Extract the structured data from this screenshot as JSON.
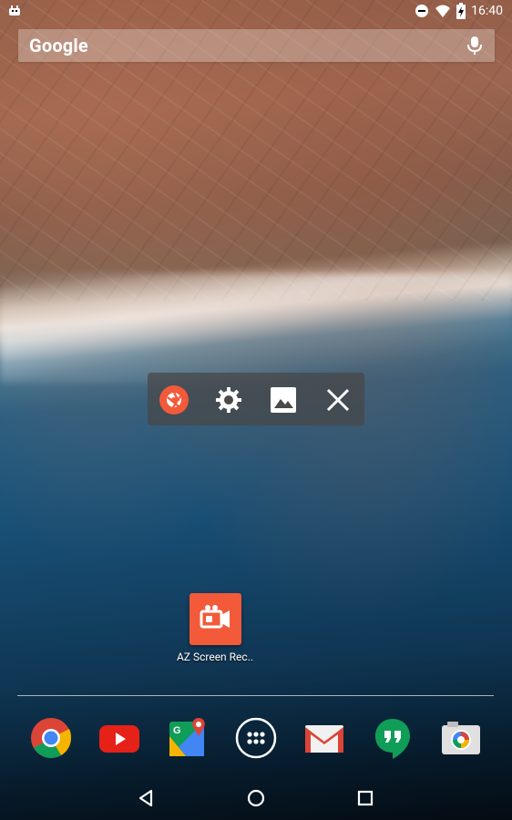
{
  "status_bar": {
    "time": "16:40",
    "icons": [
      "android-notification-icon",
      "do-not-disturb-icon",
      "wifi-icon",
      "battery-charging-icon"
    ]
  },
  "search_bar": {
    "logo_text": "Google",
    "icon": "mic-icon"
  },
  "floating_toolbar": {
    "items": [
      {
        "name": "record-shutter-icon",
        "accent": "#f25a3a"
      },
      {
        "name": "settings-gear-icon"
      },
      {
        "name": "gallery-image-icon"
      },
      {
        "name": "close-x-icon"
      }
    ]
  },
  "home_app": {
    "label": "AZ Screen Rec..",
    "icon": "camera-record-icon",
    "color": "#f25a3a"
  },
  "dock": {
    "items": [
      {
        "name": "chrome-icon"
      },
      {
        "name": "youtube-icon",
        "color": "#e62117"
      },
      {
        "name": "maps-icon"
      },
      {
        "name": "app-drawer-icon"
      },
      {
        "name": "gmail-icon"
      },
      {
        "name": "hangouts-icon",
        "color": "#0f9d58"
      },
      {
        "name": "camera-icon"
      }
    ]
  },
  "navigation": {
    "buttons": [
      "back-icon",
      "home-icon",
      "recents-icon"
    ]
  }
}
